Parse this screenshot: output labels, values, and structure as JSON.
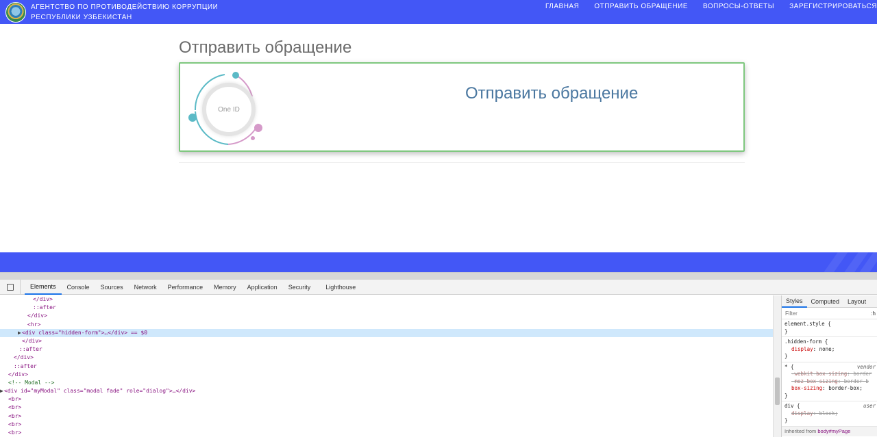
{
  "header": {
    "agency_line1": "АГЕНТСТВО ПО ПРОТИВОДЕЙСТВИЮ КОРРУПЦИИ",
    "agency_line2": "РЕСПУБЛИКИ УЗБЕКИСТАН",
    "nav": [
      {
        "label": "ГЛАВНАЯ"
      },
      {
        "label": "ОТПРАВИТЬ ОБРАЩЕНИЕ"
      },
      {
        "label": "ВОПРОСЫ-ОТВЕТЫ"
      },
      {
        "label": "ЗАРЕГИСТРИРОВАТЬСЯ"
      }
    ]
  },
  "main": {
    "page_title": "Отправить обращение",
    "card_title": "Отправить обращение",
    "oneid_label": "One ID"
  },
  "colors": {
    "brand_blue": "#4357f6",
    "card_border": "#7ec77e",
    "card_title": "#4a77a0",
    "oneid_teal": "#5bbac6",
    "oneid_pink": "#d59ac9"
  },
  "devtools": {
    "tabs": [
      "Elements",
      "Console",
      "Sources",
      "Network",
      "Performance",
      "Memory",
      "Application",
      "Security",
      "Lighthouse"
    ],
    "active_tab": "Elements",
    "dom_lines": [
      {
        "indent": 48,
        "text": "</div>"
      },
      {
        "indent": 48,
        "text": "::after",
        "pseudo": true
      },
      {
        "indent": 40,
        "text": "</div>"
      },
      {
        "indent": 40,
        "text": "<hr>"
      },
      {
        "indent": 32,
        "text": "<div class=\"hidden-form\">…</div> == $0",
        "tri": "▶",
        "selected": true
      },
      {
        "indent": 32,
        "text": "</div>"
      },
      {
        "indent": 28,
        "text": "::after",
        "pseudo": true
      },
      {
        "indent": 20,
        "text": "</div>"
      },
      {
        "indent": 20,
        "text": "::after",
        "pseudo": true
      },
      {
        "indent": 12,
        "text": "</div>"
      },
      {
        "indent": 12,
        "text": "<!-- Modal -->",
        "comment": true
      },
      {
        "indent": 4,
        "text": "<div id=\"myModal\" class=\"modal fade\" role=\"dialog\">…</div>",
        "tri": "▶"
      },
      {
        "indent": 12,
        "text": "<br>"
      },
      {
        "indent": 12,
        "text": "<br>"
      },
      {
        "indent": 12,
        "text": "<br>"
      },
      {
        "indent": 12,
        "text": "<br>"
      },
      {
        "indent": 12,
        "text": "<br>"
      }
    ],
    "styles_tabs": [
      "Styles",
      "Computed",
      "Layout"
    ],
    "styles_active": "Styles",
    "filter_placeholder": "Filter",
    "filter_hov": ":h",
    "rules": [
      {
        "selector": "element.style {",
        "props": [],
        "close": "}"
      },
      {
        "selector": ".hidden-form {",
        "props": [
          {
            "name": "display",
            "value": "none;",
            "struck": false
          }
        ],
        "close": "}"
      },
      {
        "selector": "* {",
        "source": "vendor",
        "props": [
          {
            "name": "-webkit-box-sizing",
            "value": "border",
            "struck": true
          },
          {
            "name": "-moz-box-sizing",
            "value": "border-b",
            "struck": true
          },
          {
            "name": "box-sizing",
            "value": "border-box;",
            "struck": false
          }
        ],
        "close": "}"
      },
      {
        "selector": "div {",
        "source": "user",
        "props": [
          {
            "name": "display",
            "value": "block;",
            "struck": true
          }
        ],
        "close": "}"
      }
    ],
    "inherited_label": "Inherited from",
    "inherited_target": "body#myPage"
  }
}
